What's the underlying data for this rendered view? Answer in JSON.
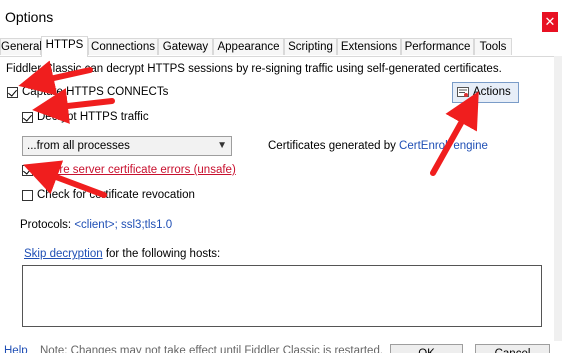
{
  "window": {
    "title": "Options",
    "close_glyph": "✕"
  },
  "tabs": [
    {
      "label": "General"
    },
    {
      "label": "HTTPS"
    },
    {
      "label": "Connections"
    },
    {
      "label": "Gateway"
    },
    {
      "label": "Appearance"
    },
    {
      "label": "Scripting"
    },
    {
      "label": "Extensions"
    },
    {
      "label": "Performance"
    },
    {
      "label": "Tools"
    }
  ],
  "https": {
    "intro": "Fiddler Classic can decrypt HTTPS sessions by re-signing traffic using self-generated certificates.",
    "capture_connects": {
      "label": "Capture HTTPS CONNECTs",
      "checked": true
    },
    "decrypt_traffic": {
      "label": "Decrypt HTTPS traffic",
      "checked": true
    },
    "process_filter": {
      "selected": "...from all processes"
    },
    "certs_prefix": "Certificates generated by ",
    "certs_engine": "CertEnroll engine",
    "ignore_errors": {
      "label": "Ignore server certificate errors (unsafe)",
      "checked": true
    },
    "check_revocation": {
      "label": "Check for certificate revocation",
      "checked": false
    },
    "protocols_label": "Protocols: ",
    "protocols_value": "<client>; ssl3;tls1.0",
    "skip_link": "Skip decryption",
    "skip_rest": " for the following hosts:",
    "actions_label": "Actions"
  },
  "footer": {
    "help": "Help",
    "note": "Note: Changes may not take effect until Fiddler Classic is restarted.",
    "ok": "OK",
    "cancel": "Cancel"
  },
  "colors": {
    "arrow": "#f01e1e",
    "link": "#1f4fb5",
    "warn": "#c8102e"
  }
}
